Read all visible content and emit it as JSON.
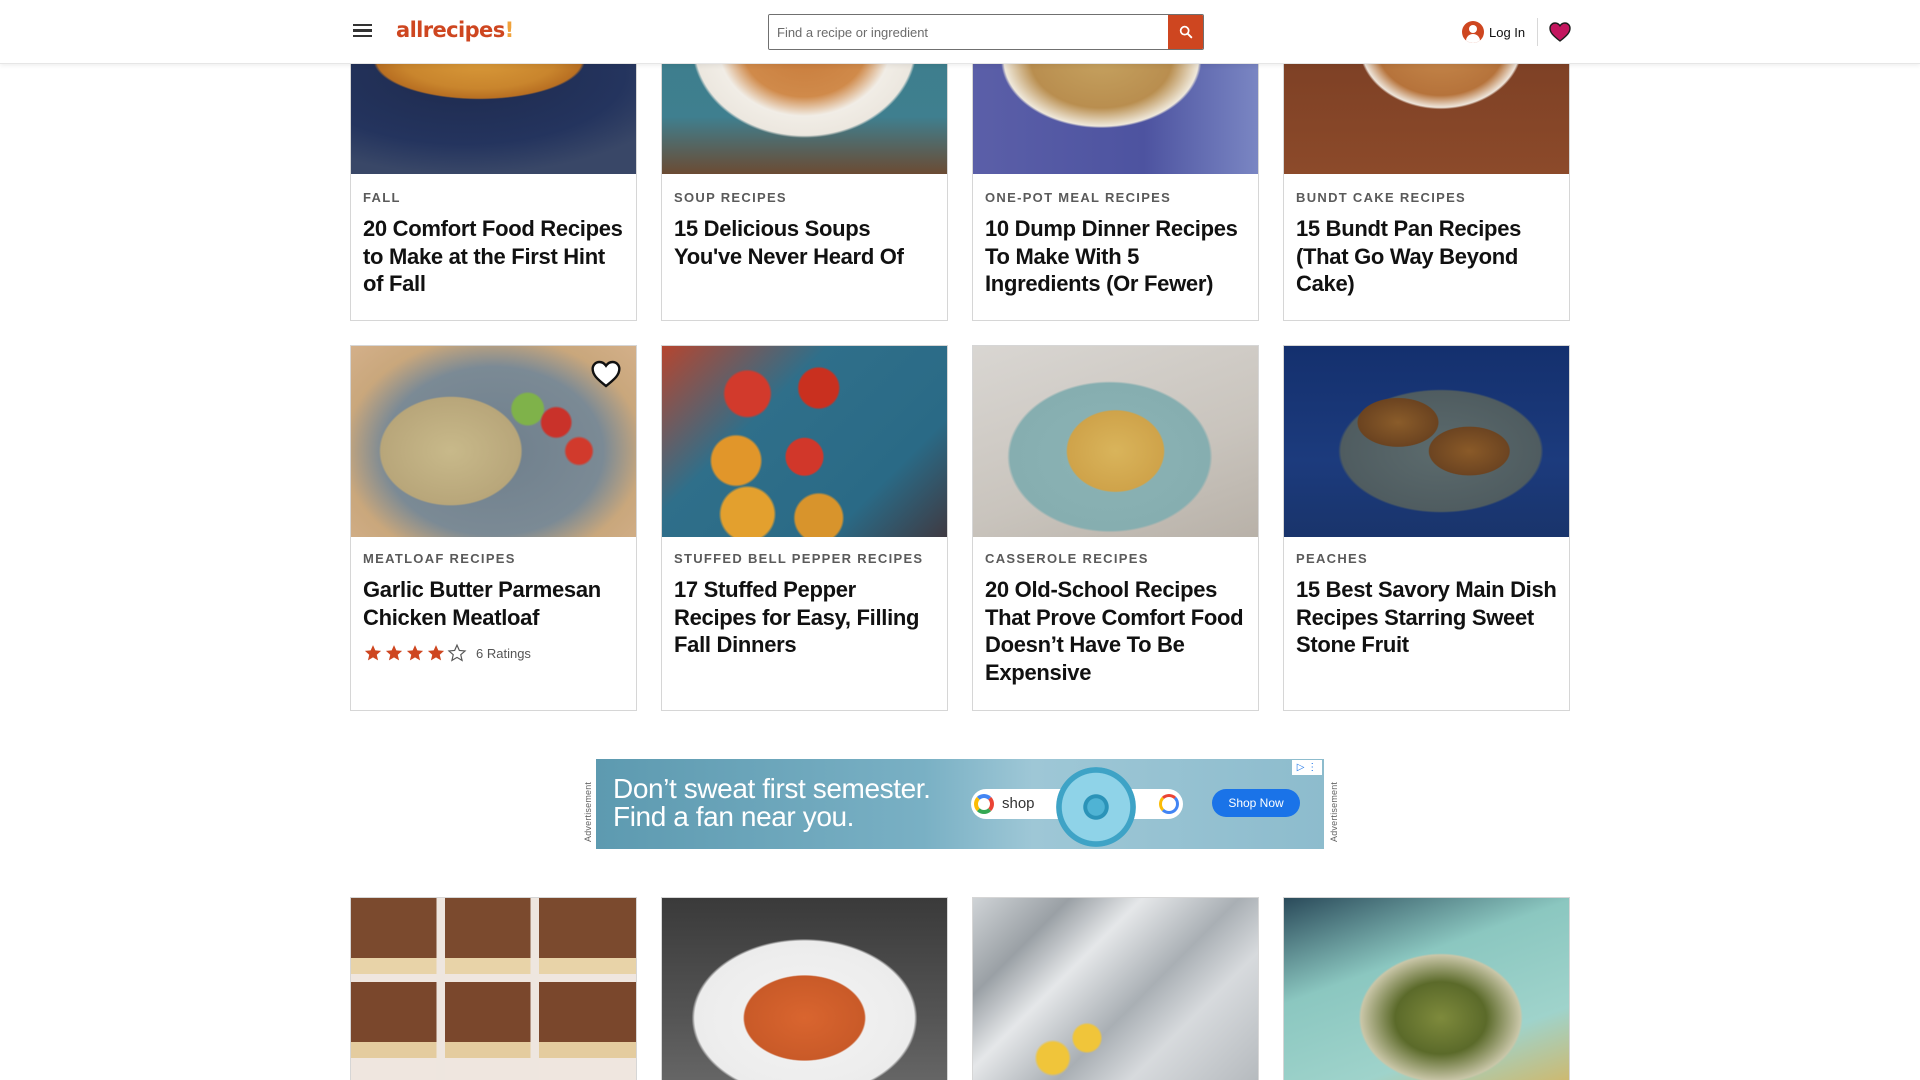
{
  "header": {
    "logo_main": "allrecipes",
    "logo_bang": "!",
    "search_placeholder": "Find a recipe or ingredient",
    "login_label": "Log In"
  },
  "rows": [
    {
      "cards": [
        {
          "tag": "Fall",
          "title": "20 Comfort Food Recipes to Make at the First Hint of Fall"
        },
        {
          "tag": "Soup Recipes",
          "title": "15 Delicious Soups You've Never Heard Of"
        },
        {
          "tag": "One-Pot Meal Recipes",
          "title": "10 Dump Dinner Recipes To Make With 5 Ingredients (Or Fewer)"
        },
        {
          "tag": "Bundt Cake Recipes",
          "title": "15 Bundt Pan Recipes (That Go Way Beyond Cake)"
        }
      ]
    },
    {
      "cards": [
        {
          "tag": "Meatloaf Recipes",
          "title": "Garlic Butter Parmesan Chicken Meatloaf",
          "rating": {
            "stars": 4,
            "max": 5,
            "count_label": "6 Ratings"
          }
        },
        {
          "tag": "Stuffed Bell Pepper Recipes",
          "title": "17 Stuffed Pepper Recipes for Easy, Filling Fall Dinners"
        },
        {
          "tag": "Casserole Recipes",
          "title": "20 Old-School Recipes That Prove Comfort Food Doesn’t Have To Be Expensive"
        },
        {
          "tag": "Peaches",
          "title": "15 Best Savory Main Dish Recipes Starring Sweet Stone Fruit"
        }
      ]
    }
  ],
  "advertisement": {
    "label": "Advertisement",
    "headline_line1": "Don’t sweat first semester.",
    "headline_line2": "Find a fan near you.",
    "shop_text": "shop",
    "cta": "Shop Now"
  },
  "colors": {
    "brand": "#ce4620",
    "favorite_heart": "#c3165e",
    "star": "#ce4620"
  },
  "icons": [
    "menu-icon",
    "search-icon",
    "user-icon",
    "heart-icon",
    "star-icon",
    "save-heart-icon"
  ]
}
